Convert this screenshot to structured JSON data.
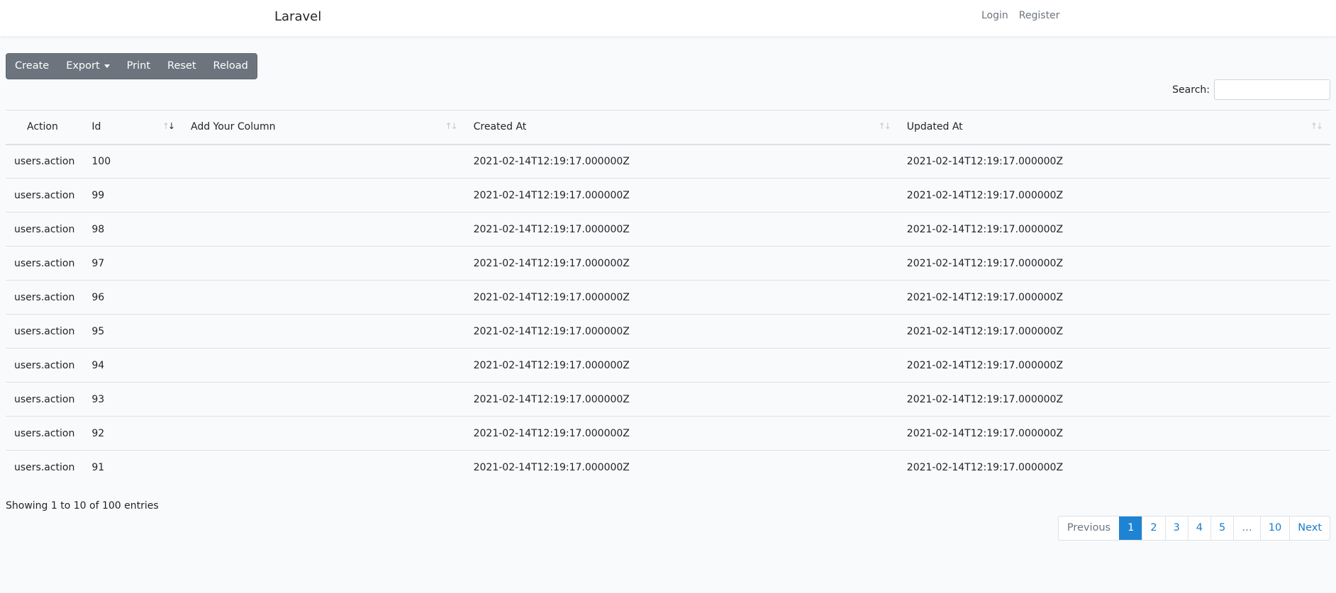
{
  "navbar": {
    "brand": "Laravel",
    "login": "Login",
    "register": "Register"
  },
  "toolbar": {
    "create": "Create",
    "export": "Export",
    "print": "Print",
    "reset": "Reset",
    "reload": "Reload"
  },
  "search": {
    "label": "Search:",
    "value": ""
  },
  "table": {
    "headers": {
      "action": "Action",
      "id": "Id",
      "add_column": "Add Your Column",
      "created_at": "Created At",
      "updated_at": "Updated At"
    },
    "sorted_column": "id",
    "sort_direction": "desc",
    "rows": [
      {
        "action": "users.action",
        "id": "100",
        "add_column": "",
        "created_at": "2021-02-14T12:19:17.000000Z",
        "updated_at": "2021-02-14T12:19:17.000000Z"
      },
      {
        "action": "users.action",
        "id": "99",
        "add_column": "",
        "created_at": "2021-02-14T12:19:17.000000Z",
        "updated_at": "2021-02-14T12:19:17.000000Z"
      },
      {
        "action": "users.action",
        "id": "98",
        "add_column": "",
        "created_at": "2021-02-14T12:19:17.000000Z",
        "updated_at": "2021-02-14T12:19:17.000000Z"
      },
      {
        "action": "users.action",
        "id": "97",
        "add_column": "",
        "created_at": "2021-02-14T12:19:17.000000Z",
        "updated_at": "2021-02-14T12:19:17.000000Z"
      },
      {
        "action": "users.action",
        "id": "96",
        "add_column": "",
        "created_at": "2021-02-14T12:19:17.000000Z",
        "updated_at": "2021-02-14T12:19:17.000000Z"
      },
      {
        "action": "users.action",
        "id": "95",
        "add_column": "",
        "created_at": "2021-02-14T12:19:17.000000Z",
        "updated_at": "2021-02-14T12:19:17.000000Z"
      },
      {
        "action": "users.action",
        "id": "94",
        "add_column": "",
        "created_at": "2021-02-14T12:19:17.000000Z",
        "updated_at": "2021-02-14T12:19:17.000000Z"
      },
      {
        "action": "users.action",
        "id": "93",
        "add_column": "",
        "created_at": "2021-02-14T12:19:17.000000Z",
        "updated_at": "2021-02-14T12:19:17.000000Z"
      },
      {
        "action": "users.action",
        "id": "92",
        "add_column": "",
        "created_at": "2021-02-14T12:19:17.000000Z",
        "updated_at": "2021-02-14T12:19:17.000000Z"
      },
      {
        "action": "users.action",
        "id": "91",
        "add_column": "",
        "created_at": "2021-02-14T12:19:17.000000Z",
        "updated_at": "2021-02-14T12:19:17.000000Z"
      }
    ]
  },
  "info": "Showing 1 to 10 of 100 entries",
  "pagination": {
    "previous": "Previous",
    "next": "Next",
    "pages": [
      "1",
      "2",
      "3",
      "4",
      "5",
      "…",
      "10"
    ],
    "active": "1"
  },
  "colors": {
    "button_bg": "#6c757d",
    "link": "#1b7bc9",
    "active_page": "#1f83d4",
    "page_bg": "#f8fafc"
  }
}
